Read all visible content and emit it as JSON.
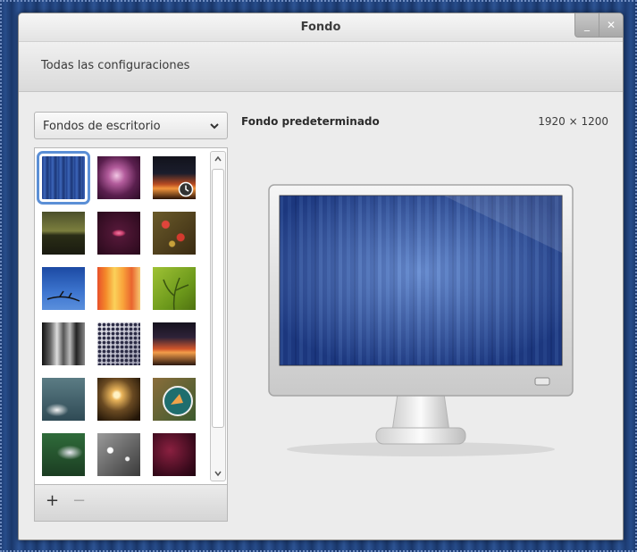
{
  "window": {
    "title": "Fondo"
  },
  "toolbar": {
    "all_settings": "Todas las configuraciones"
  },
  "wallpaper_source": {
    "selected": "Fondos de escritorio"
  },
  "preview": {
    "title": "Fondo predeterminado",
    "resolution": "1920 × 1200"
  },
  "thumbnails": [
    {
      "id": "blue-curtain",
      "selected": true,
      "slideshow": false
    },
    {
      "id": "purple-glow",
      "selected": false,
      "slideshow": false
    },
    {
      "id": "sunset-sky",
      "selected": false,
      "slideshow": true
    },
    {
      "id": "dark-field",
      "selected": false,
      "slideshow": false
    },
    {
      "id": "pink-lips",
      "selected": false,
      "slideshow": false
    },
    {
      "id": "red-berries",
      "selected": false,
      "slideshow": false
    },
    {
      "id": "blue-branch",
      "selected": false,
      "slideshow": false
    },
    {
      "id": "orange-stripes",
      "selected": false,
      "slideshow": false
    },
    {
      "id": "green-plant",
      "selected": false,
      "slideshow": false
    },
    {
      "id": "bw-building",
      "selected": false,
      "slideshow": false
    },
    {
      "id": "perforated-metal",
      "selected": false,
      "slideshow": false
    },
    {
      "id": "sunset-clouds",
      "selected": false,
      "slideshow": false
    },
    {
      "id": "teal-clouds",
      "selected": false,
      "slideshow": false
    },
    {
      "id": "sunset-grass",
      "selected": false,
      "slideshow": false
    },
    {
      "id": "road-sign",
      "selected": false,
      "slideshow": false
    },
    {
      "id": "white-flower",
      "selected": false,
      "slideshow": false
    },
    {
      "id": "bw-drops",
      "selected": false,
      "slideshow": false
    },
    {
      "id": "dark-red",
      "selected": false,
      "slideshow": false
    }
  ],
  "footer": {
    "add": "+",
    "remove": "−"
  },
  "window_buttons": {
    "minimize": "_",
    "close": "✕"
  }
}
